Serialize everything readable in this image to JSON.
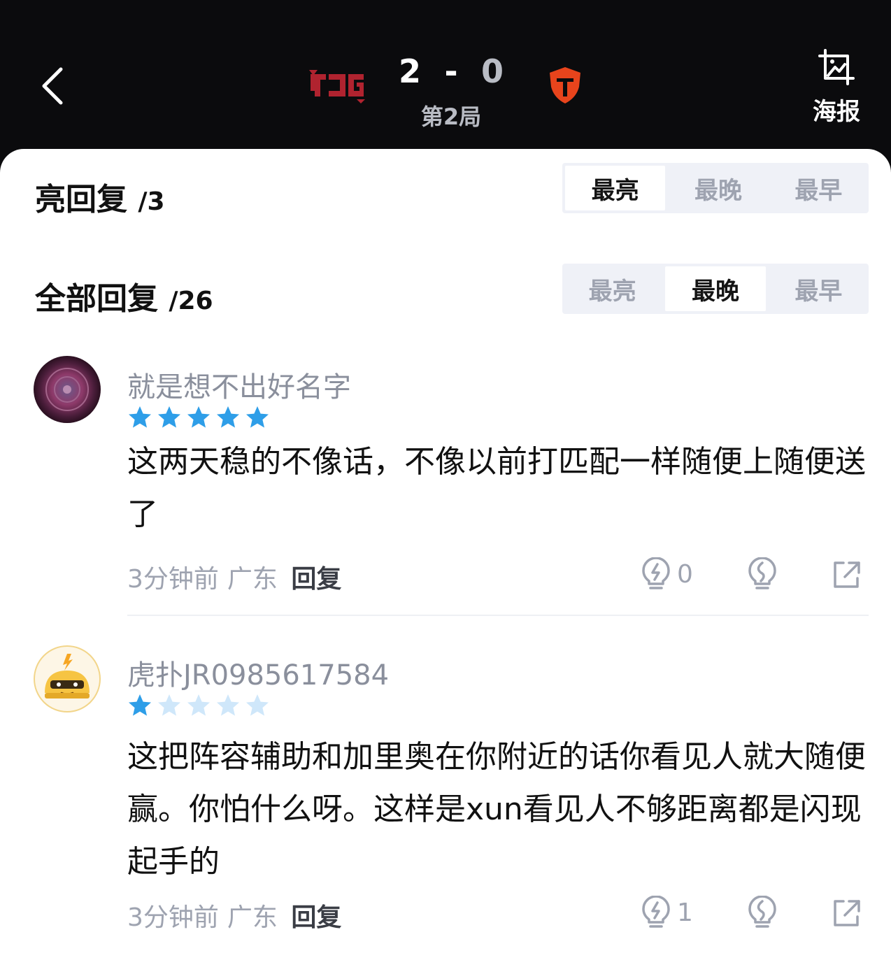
{
  "header": {
    "score_left": "2",
    "score_sep": "-",
    "score_right": "0",
    "round": "第2局",
    "poster_label": "海报",
    "team_left_icon": "jdg-logo",
    "team_right_icon": "tes-logo",
    "colors": {
      "background": "#0b0b0d",
      "team_left": "#b0232f",
      "team_right": "#e8441c"
    }
  },
  "highlight": {
    "title": "亮回复",
    "count": "/3",
    "tabs": [
      "最亮",
      "最晚",
      "最早"
    ],
    "active_tab": "最亮"
  },
  "all": {
    "title": "全部回复",
    "count": "/26",
    "tabs": [
      "最亮",
      "最晚",
      "最早"
    ],
    "active_tab": "最晚"
  },
  "comments": [
    {
      "username": "就是想不出好名字",
      "rating": 5,
      "text": "这两天稳的不像话，不像以前打匹配一样随便上随便送了",
      "time": "3分钟前",
      "location": "广东",
      "reply_label": "回复",
      "light_count": "0"
    },
    {
      "username": "虎扑JR0985617584",
      "rating": 1,
      "text": "这把阵容辅助和加里奥在你附近的话你看见人就大随便赢。你怕什么呀。这样是xun看见人不够距离都是闪现起手的",
      "time": "3分钟前",
      "location": "广东",
      "reply_label": "回复",
      "light_count": "1"
    }
  ],
  "colors": {
    "star_on": "#2e9ee8",
    "star_off": "#cfe7fa",
    "accent_text": "#111111",
    "muted_text": "#9ea3b0"
  }
}
